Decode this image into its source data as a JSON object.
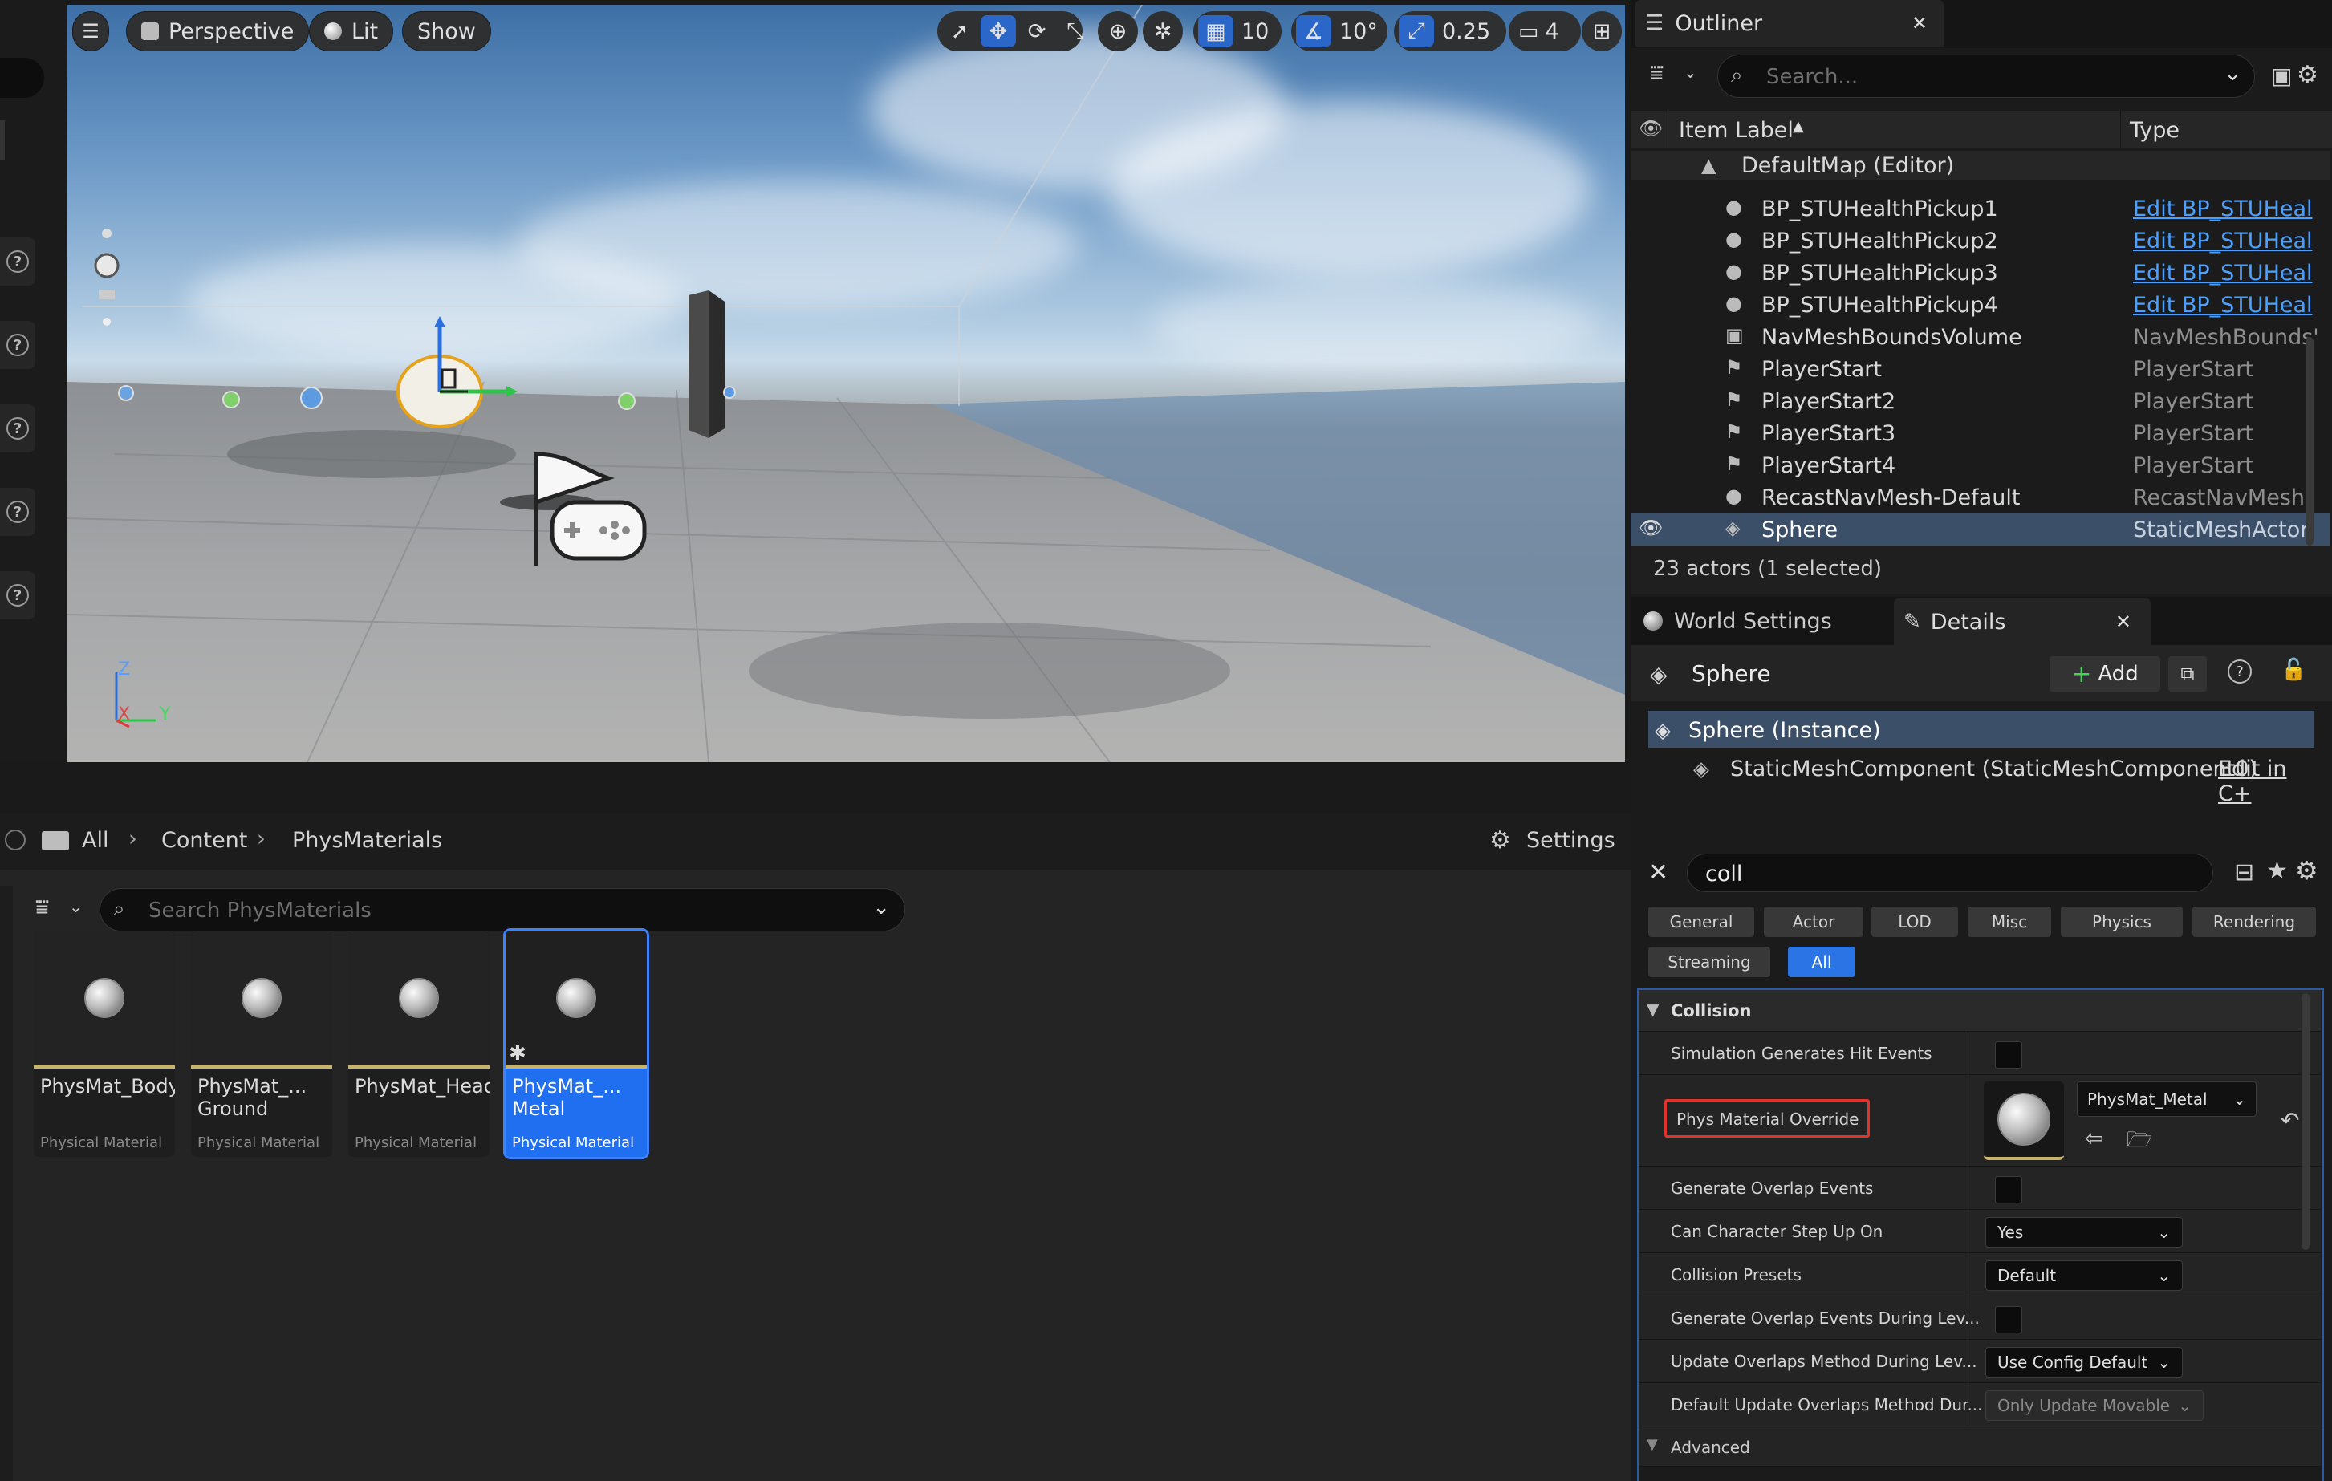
{
  "viewport": {
    "view_mode": "Perspective",
    "lighting": "Lit",
    "show": "Show",
    "grid_snap": "10",
    "rotation_snap": "10°",
    "scale_snap": "0.25",
    "camera_speed": "4",
    "axis_z": "Z",
    "axis_x": "X",
    "axis_y": "Y"
  },
  "content_browser": {
    "breadcrumb": [
      "All",
      "Content",
      "PhysMaterials"
    ],
    "settings_label": "Settings",
    "search_placeholder": "Search PhysMaterials",
    "assets": [
      {
        "name": "PhysMat_Body",
        "type": "Physical Material"
      },
      {
        "name": "PhysMat_...\nGround",
        "type": "Physical Material"
      },
      {
        "name": "PhysMat_Head",
        "type": "Physical Material"
      },
      {
        "name": "PhysMat_...\nMetal",
        "type": "Physical Material"
      }
    ]
  },
  "outliner": {
    "title": "Outliner",
    "search_placeholder": "Search...",
    "col_label": "Item Label",
    "col_type": "Type",
    "items": [
      {
        "label": "DefaultMap (Editor)",
        "type": ""
      },
      {
        "label": "BP_STUHealthPickup1",
        "type": "Edit BP_STUHeal"
      },
      {
        "label": "BP_STUHealthPickup2",
        "type": "Edit BP_STUHeal"
      },
      {
        "label": "BP_STUHealthPickup3",
        "type": "Edit BP_STUHeal"
      },
      {
        "label": "BP_STUHealthPickup4",
        "type": "Edit BP_STUHeal"
      },
      {
        "label": "NavMeshBoundsVolume",
        "type": "NavMeshBounds'"
      },
      {
        "label": "PlayerStart",
        "type": "PlayerStart"
      },
      {
        "label": "PlayerStart2",
        "type": "PlayerStart"
      },
      {
        "label": "PlayerStart3",
        "type": "PlayerStart"
      },
      {
        "label": "PlayerStart4",
        "type": "PlayerStart"
      },
      {
        "label": "RecastNavMesh-Default",
        "type": "RecastNavMesh"
      },
      {
        "label": "Sphere",
        "type": "StaticMeshActor"
      }
    ],
    "status": "23 actors (1 selected)"
  },
  "details": {
    "tab_world": "World Settings",
    "tab_details": "Details",
    "actor_name": "Sphere",
    "add_label": "Add",
    "instance_label": "Sphere (Instance)",
    "component_label": "StaticMeshComponent (StaticMeshComponent0)",
    "component_edit": "Edit in C+",
    "search_value": "coll",
    "filters": [
      "General",
      "Actor",
      "LOD",
      "Misc",
      "Physics",
      "Rendering",
      "Streaming",
      "All"
    ],
    "section_collision": "Collision",
    "section_advanced": "Advanced",
    "props": {
      "sim_hit": "Simulation Generates Hit Events",
      "phys_override": "Phys Material Override",
      "phys_value": "PhysMat_Metal",
      "gen_overlap": "Generate Overlap Events",
      "step_up": "Can Character Step Up On",
      "step_up_value": "Yes",
      "presets": "Collision Presets",
      "presets_value": "Default",
      "gen_overlap_level": "Generate Overlap Events During Lev...",
      "update_overlaps": "Update Overlaps Method During Lev...",
      "update_overlaps_value": "Use Config Default",
      "default_update": "Default Update Overlaps Method Dur...",
      "default_update_value": "Only Update Movable"
    }
  },
  "colors": {
    "accent": "#2b74e6",
    "highlight_box": "#e0342b",
    "link": "#4aa0ff"
  }
}
